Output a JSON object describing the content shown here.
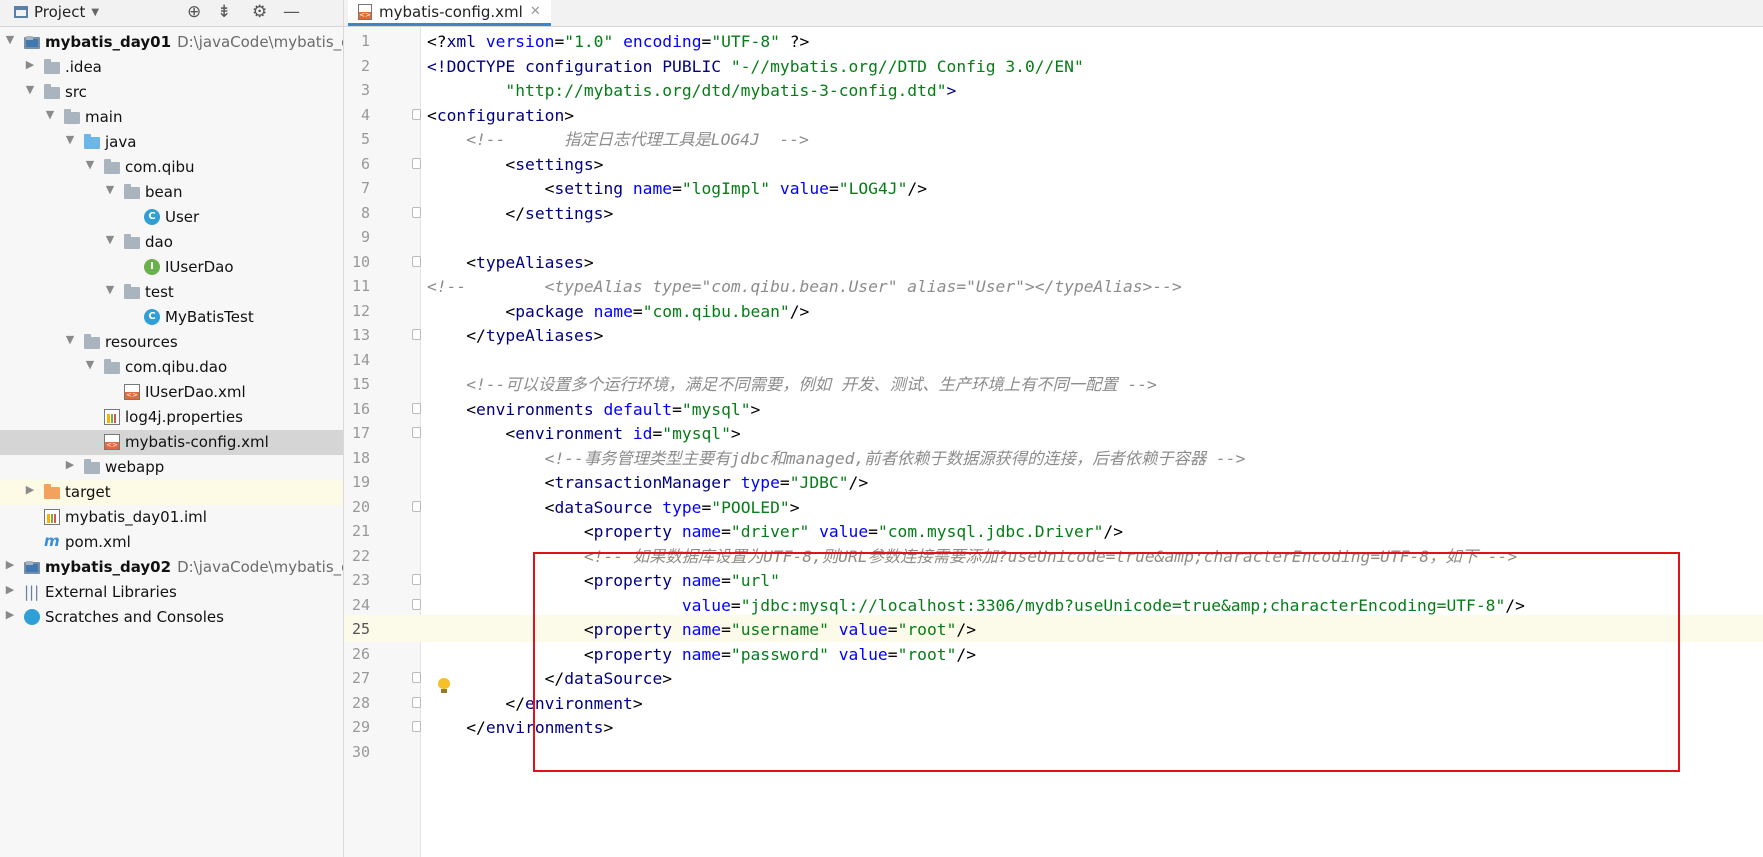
{
  "project_panel": {
    "title": "Project",
    "tree": [
      {
        "label": "mybatis_day01",
        "path": "D:\\javaCode\\mybatis_da",
        "bold": true,
        "depth": 0,
        "arrow": "open",
        "icon": "module-icon"
      },
      {
        "label": ".idea",
        "depth": 1,
        "arrow": "closed",
        "icon": "folder-icon"
      },
      {
        "label": "src",
        "depth": 1,
        "arrow": "open",
        "icon": "folder-icon"
      },
      {
        "label": "main",
        "depth": 2,
        "arrow": "open",
        "icon": "folder-icon"
      },
      {
        "label": "java",
        "depth": 3,
        "arrow": "open",
        "icon": "source-folder-icon"
      },
      {
        "label": "com.qibu",
        "depth": 4,
        "arrow": "open",
        "icon": "package-icon"
      },
      {
        "label": "bean",
        "depth": 5,
        "arrow": "open",
        "icon": "package-icon"
      },
      {
        "label": "User",
        "depth": 6,
        "arrow": "none",
        "icon": "class-icon"
      },
      {
        "label": "dao",
        "depth": 5,
        "arrow": "open",
        "icon": "package-icon"
      },
      {
        "label": "IUserDao",
        "depth": 6,
        "arrow": "none",
        "icon": "interface-icon"
      },
      {
        "label": "test",
        "depth": 5,
        "arrow": "open",
        "icon": "package-icon"
      },
      {
        "label": "MyBatisTest",
        "depth": 6,
        "arrow": "none",
        "icon": "class-icon"
      },
      {
        "label": "resources",
        "depth": 3,
        "arrow": "open",
        "icon": "resources-folder-icon"
      },
      {
        "label": "com.qibu.dao",
        "depth": 4,
        "arrow": "open",
        "icon": "package-icon"
      },
      {
        "label": "IUserDao.xml",
        "depth": 5,
        "arrow": "none",
        "icon": "xml-file-icon"
      },
      {
        "label": "log4j.properties",
        "depth": 4,
        "arrow": "none",
        "icon": "properties-file-icon"
      },
      {
        "label": "mybatis-config.xml",
        "depth": 4,
        "arrow": "none",
        "icon": "xml-file-icon",
        "selected": true
      },
      {
        "label": "webapp",
        "depth": 3,
        "arrow": "closed",
        "icon": "web-folder-icon"
      },
      {
        "label": "target",
        "depth": 1,
        "arrow": "closed",
        "icon": "excluded-folder-icon",
        "highlight": true
      },
      {
        "label": "mybatis_day01.iml",
        "depth": 1,
        "arrow": "none",
        "icon": "iml-file-icon"
      },
      {
        "label": "pom.xml",
        "depth": 1,
        "arrow": "none",
        "icon": "maven-icon"
      },
      {
        "label": "mybatis_day02",
        "path": "D:\\javaCode\\mybatis_da",
        "bold": true,
        "depth": 0,
        "arrow": "closed",
        "icon": "module-icon"
      },
      {
        "label": "External Libraries",
        "depth": 0,
        "arrow": "closed",
        "icon": "libraries-icon"
      },
      {
        "label": "Scratches and Consoles",
        "depth": 0,
        "arrow": "closed",
        "icon": "scratches-icon"
      }
    ]
  },
  "editor": {
    "tab_label": "mybatis-config.xml",
    "current_line": 25,
    "colors": {
      "tag": "#000080",
      "attr": "#0000ff",
      "value": "#067d17",
      "comment": "#8c8c8c",
      "punct": "#000000",
      "highlight_box": "#e3111a"
    },
    "lines": [
      [
        [
          "p",
          "<?"
        ],
        [
          "t",
          "xml"
        ],
        [
          "a",
          " version"
        ],
        [
          "p",
          "="
        ],
        [
          "v",
          "\"1.0\""
        ],
        [
          "a",
          " encoding"
        ],
        [
          "p",
          "="
        ],
        [
          "v",
          "\"UTF-8\""
        ],
        [
          "p",
          " ?>"
        ]
      ],
      [
        [
          "t",
          "<!DOCTYPE configuration PUBLIC "
        ],
        [
          "v",
          "\"-//mybatis.org//DTD Config 3.0//EN\""
        ]
      ],
      [
        [
          "p",
          "        "
        ],
        [
          "v",
          "\"http://mybatis.org/dtd/mybatis-3-config.dtd\""
        ],
        [
          "t",
          ">"
        ]
      ],
      [
        [
          "p",
          "<"
        ],
        [
          "t",
          "configuration"
        ],
        [
          "p",
          ">"
        ]
      ],
      [
        [
          "p",
          "    "
        ],
        [
          "c",
          "<!--      指定日志代理工具是LOG4J  -->"
        ]
      ],
      [
        [
          "p",
          "        <"
        ],
        [
          "t",
          "settings"
        ],
        [
          "p",
          ">"
        ]
      ],
      [
        [
          "p",
          "            <"
        ],
        [
          "t",
          "setting"
        ],
        [
          "a",
          " name"
        ],
        [
          "p",
          "="
        ],
        [
          "v",
          "\"logImpl\""
        ],
        [
          "a",
          " value"
        ],
        [
          "p",
          "="
        ],
        [
          "v",
          "\"LOG4J\""
        ],
        [
          "p",
          "/>"
        ]
      ],
      [
        [
          "p",
          "        </"
        ],
        [
          "t",
          "settings"
        ],
        [
          "p",
          ">"
        ]
      ],
      [
        [
          "p",
          ""
        ]
      ],
      [
        [
          "p",
          "    <"
        ],
        [
          "t",
          "typeAliases"
        ],
        [
          "p",
          ">"
        ]
      ],
      [
        [
          "c",
          "<!--        <typeAlias type=\"com.qibu.bean.User\" alias=\"User\"></typeAlias>-->"
        ]
      ],
      [
        [
          "p",
          "        <"
        ],
        [
          "t",
          "package"
        ],
        [
          "a",
          " name"
        ],
        [
          "p",
          "="
        ],
        [
          "v",
          "\"com.qibu.bean\""
        ],
        [
          "p",
          "/>"
        ]
      ],
      [
        [
          "p",
          "    </"
        ],
        [
          "t",
          "typeAliases"
        ],
        [
          "p",
          ">"
        ]
      ],
      [
        [
          "p",
          ""
        ]
      ],
      [
        [
          "p",
          "    "
        ],
        [
          "c",
          "<!--可以设置多个运行环境，满足不同需要，例如 开发、测试、生产环境上有不同一配置 -->"
        ]
      ],
      [
        [
          "p",
          "    <"
        ],
        [
          "t",
          "environments"
        ],
        [
          "a",
          " default"
        ],
        [
          "p",
          "="
        ],
        [
          "v",
          "\"mysql\""
        ],
        [
          "p",
          ">"
        ]
      ],
      [
        [
          "p",
          "        <"
        ],
        [
          "t",
          "environment"
        ],
        [
          "a",
          " id"
        ],
        [
          "p",
          "="
        ],
        [
          "v",
          "\"mysql\""
        ],
        [
          "p",
          ">"
        ]
      ],
      [
        [
          "p",
          "            "
        ],
        [
          "c",
          "<!--事务管理类型主要有jdbc和managed,前者依赖于数据源获得的连接，后者依赖于容器 -->"
        ]
      ],
      [
        [
          "p",
          "            <"
        ],
        [
          "t",
          "transactionManager"
        ],
        [
          "a",
          " type"
        ],
        [
          "p",
          "="
        ],
        [
          "v",
          "\"JDBC\""
        ],
        [
          "p",
          "/>"
        ]
      ],
      [
        [
          "p",
          "            <"
        ],
        [
          "t",
          "dataSource"
        ],
        [
          "a",
          " type"
        ],
        [
          "p",
          "="
        ],
        [
          "v",
          "\"POOLED\""
        ],
        [
          "p",
          ">"
        ]
      ],
      [
        [
          "p",
          "                <"
        ],
        [
          "t",
          "property"
        ],
        [
          "a",
          " name"
        ],
        [
          "p",
          "="
        ],
        [
          "v",
          "\"driver\""
        ],
        [
          "a",
          " value"
        ],
        [
          "p",
          "="
        ],
        [
          "v",
          "\"com.mysql.jdbc.Driver\""
        ],
        [
          "p",
          "/>"
        ]
      ],
      [
        [
          "p",
          "                "
        ],
        [
          "c",
          "<!-- 如果数据库设置为UTF-8,则URL参数连接需要添加?useUnicode=true&amp;characterEncoding=UTF-8，如下 -->"
        ]
      ],
      [
        [
          "p",
          "                <"
        ],
        [
          "t",
          "property"
        ],
        [
          "a",
          " name"
        ],
        [
          "p",
          "="
        ],
        [
          "v",
          "\"url\""
        ]
      ],
      [
        [
          "p",
          "                          "
        ],
        [
          "a",
          "value"
        ],
        [
          "p",
          "="
        ],
        [
          "v",
          "\"jdbc:mysql://localhost:3306/mydb?useUnicode=true&amp;characterEncoding=UTF-8\""
        ],
        [
          "p",
          "/>"
        ]
      ],
      [
        [
          "p",
          "                <"
        ],
        [
          "t",
          "property"
        ],
        [
          "a",
          " name"
        ],
        [
          "p",
          "="
        ],
        [
          "v",
          "\"username\""
        ],
        [
          "a",
          " value"
        ],
        [
          "p",
          "="
        ],
        [
          "v",
          "\"root\""
        ],
        [
          "p",
          "/>"
        ]
      ],
      [
        [
          "p",
          "                <"
        ],
        [
          "t",
          "property"
        ],
        [
          "a",
          " name"
        ],
        [
          "p",
          "="
        ],
        [
          "v",
          "\"password\""
        ],
        [
          "a",
          " value"
        ],
        [
          "p",
          "="
        ],
        [
          "v",
          "\"root\""
        ],
        [
          "p",
          "/>"
        ]
      ],
      [
        [
          "p",
          "            </"
        ],
        [
          "t",
          "dataSource"
        ],
        [
          "p",
          ">"
        ]
      ],
      [
        [
          "p",
          "        </"
        ],
        [
          "t",
          "environment"
        ],
        [
          "p",
          ">"
        ]
      ],
      [
        [
          "p",
          "    </"
        ],
        [
          "t",
          "environments"
        ],
        [
          "p",
          ">"
        ]
      ],
      [
        [
          "p",
          ""
        ]
      ]
    ]
  }
}
